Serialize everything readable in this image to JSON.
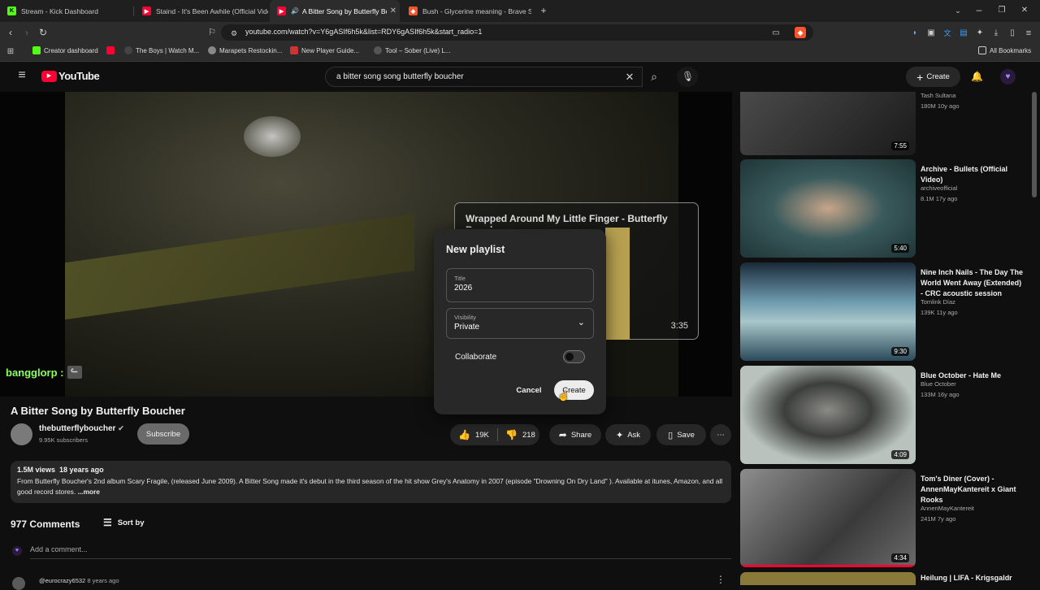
{
  "browser": {
    "tabs": [
      {
        "title": "Stream - Kick Dashboard",
        "favicon_color": "#53fc18",
        "favicon_letter": "K"
      },
      {
        "title": "Staind - It's Been Awhile (Official Vide",
        "favicon_color": "#ff0033",
        "favicon_letter": "▶"
      },
      {
        "title": "A Bitter Song by Butterfly Bou",
        "favicon_color": "#ff0033",
        "favicon_letter": "▶",
        "active": true
      },
      {
        "title": "Bush - Glycerine meaning - Brave Sea",
        "favicon_color": "#fb542b",
        "favicon_letter": "◆"
      }
    ],
    "url": "youtube.com/watch?v=Y6gASIf6h5k&list=RDY6gASIf6h5k&start_radio=1",
    "bookmarks": [
      {
        "label": "Creator dashboard",
        "color": "#53fc18"
      },
      {
        "label": "",
        "color": "#ff0033"
      },
      {
        "label": "The Boys | Watch M...",
        "color": "#444"
      },
      {
        "label": "Marapets Restockin...",
        "color": "#888"
      },
      {
        "label": "New Player Guide...",
        "color": "#c33"
      },
      {
        "label": "Tool – Sober (Live) L...",
        "color": "#555"
      }
    ],
    "all_bookmarks": "All Bookmarks"
  },
  "youtube": {
    "logo_text": "YouTube",
    "search_query": "a bitter song song butterfly boucher",
    "create_label": "Create"
  },
  "player": {
    "chat_overlay": "bangglorp :",
    "endcard_title": "Wrapped Around My Little Finger - Butterfly Boucher",
    "endcard_duration": "3:35"
  },
  "video": {
    "title": "A Bitter Song by Butterfly Boucher",
    "channel": "thebutterflyboucher",
    "subscribers": "9.95K subscribers",
    "subscribe_label": "Subscribe",
    "likes": "19K",
    "dislikes": "218",
    "share_label": "Share",
    "ask_label": "Ask",
    "save_label": "Save",
    "views": "1.5M views",
    "age": "18 years ago",
    "description": "From Butterfly Boucher's 2nd album Scary Fragile, (released June 2009). A Bitter Song made it's debut in the third season of  the hit show Grey's Anatomy in 2007 (episode \"Drowning On Dry Land\" ). Available at itunes, Amazon, and all good record stores.",
    "more_label": "...more",
    "comments_count": "977 Comments",
    "sort_label": "Sort by",
    "add_comment_placeholder": "Add a comment...",
    "first_comment_author": "@eurocrazy6532",
    "first_comment_age": "8 years ago"
  },
  "sidebar": [
    {
      "title": "",
      "channel": "Tash Sultana",
      "meta": "180M  10y ago",
      "duration": "7:55",
      "color": "#2a2a2a"
    },
    {
      "title": "Archive - Bullets (Official Video)",
      "channel": "archiveofficial",
      "meta": "8.1M  17y ago",
      "duration": "5:40",
      "color": "#3a5a5c"
    },
    {
      "title": "Nine Inch Nails - The Day The World Went Away (Extended) - CRC acoustic session",
      "channel": "Tomlink Díaz",
      "meta": "139K  11y ago",
      "duration": "9:30",
      "color": "#5a8aa0"
    },
    {
      "title": "Blue October - Hate Me",
      "channel": "Blue October",
      "meta": "133M  16y ago",
      "duration": "4:09",
      "color": "#b9c2bd"
    },
    {
      "title": "Tom's Diner (Cover) - AnnenMayKantereit x Giant Rooks",
      "channel": "AnnenMayKantereit",
      "meta": "241M  7y ago",
      "duration": "4:34",
      "color": "#6d6d6d"
    },
    {
      "title": "Heilung | LIFA - Krigsgaldr",
      "channel": "",
      "meta": "",
      "duration": "",
      "color": "#8a7a3a"
    }
  ],
  "dialog": {
    "heading": "New playlist",
    "title_label": "Title",
    "title_value": "2026",
    "visibility_label": "Visibility",
    "visibility_value": "Private",
    "collaborate_label": "Collaborate",
    "cancel_label": "Cancel",
    "create_label": "Create"
  }
}
